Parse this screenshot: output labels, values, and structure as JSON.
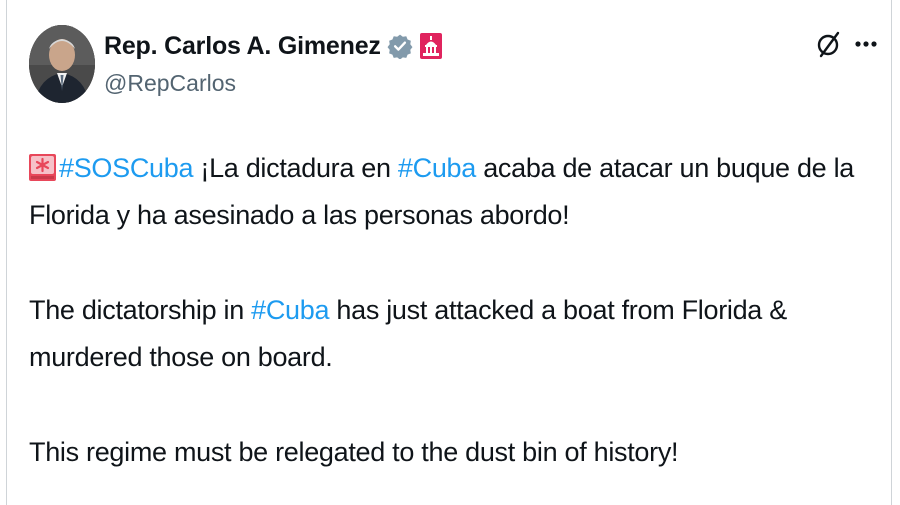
{
  "author": {
    "display_name": "Rep. Carlos A. Gimenez",
    "handle": "@RepCarlos",
    "verified": true,
    "affiliation_badge": "us-capitol-icon",
    "avatar": "portrait-of-man-in-suit"
  },
  "header_actions": {
    "grok_icon": "grok-slash-circle-icon",
    "more_icon": "more-horizontal-icon"
  },
  "tweet": {
    "p1": {
      "emoji": "siren-emoji",
      "tag1": "#SOSCuba",
      "text1": " ¡La dictadura en ",
      "tag2": "#Cuba",
      "text2": " acaba de atacar un buque de la Florida y ha asesinado a las personas abordo!"
    },
    "p2": {
      "text1": "The dictatorship in ",
      "tag1": "#Cuba",
      "text2": " has just attacked a boat from Florida & murdered those on board."
    },
    "p3": {
      "text1": "This regime must be relegated to the dust bin of history!"
    }
  },
  "colors": {
    "text": "#0f1419",
    "secondary": "#536471",
    "link": "#1d9bf0",
    "verified_badge": "#829aab",
    "affiliation_red": "#e0245e"
  }
}
